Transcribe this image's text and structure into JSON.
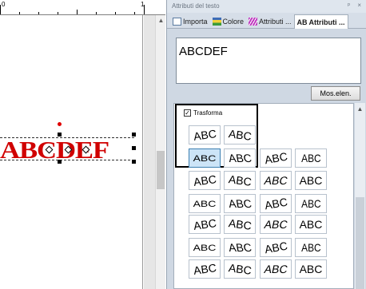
{
  "ruler": {
    "label_left": "0",
    "label_right": "1"
  },
  "canvas": {
    "embroidery_text": "ABCDEF",
    "text_color": "#d00000"
  },
  "panel": {
    "title": "Attributi del testo",
    "pin_glyph": "ᵖ",
    "close_glyph": "×",
    "tabs": [
      {
        "label": "Importa",
        "icon": "import-icon"
      },
      {
        "label": "Colore",
        "icon": "color-icon"
      },
      {
        "label": "Attributi ...",
        "icon": "attributes-icon"
      },
      {
        "label": "Attributi ...",
        "icon": "text-attributes-icon",
        "prefix": "AB",
        "active": true
      }
    ],
    "text_value": "ABCDEF",
    "show_list_button": "Mos.elen.",
    "transform_label": "Trasforma",
    "transform_checked": true
  },
  "transform_tiles": [
    [
      "ABC",
      "ABC"
    ],
    [
      "ABC",
      "ABC",
      "ABC",
      "ABC"
    ],
    [
      "ABC",
      "ABC",
      "ABC",
      "ABC"
    ],
    [
      "ABC",
      "ABC",
      "ABC",
      "ABC"
    ],
    [
      "ABC",
      "ABC",
      "ABC",
      "ABC"
    ],
    [
      "ABC",
      "ABC",
      "ABC",
      "ABC"
    ],
    [
      "ABC",
      "ABC",
      "ABC",
      "ABC"
    ]
  ],
  "selected_tile": "1-0"
}
